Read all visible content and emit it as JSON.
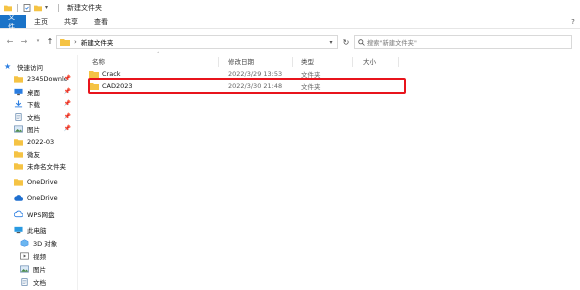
{
  "window": {
    "title": "新建文件夹"
  },
  "ribbon": {
    "tabs": [
      "文件",
      "主页",
      "共享",
      "查看"
    ],
    "help": "?"
  },
  "address": {
    "breadcrumb": "新建文件夹",
    "search_placeholder": "搜索\"新建文件夹\""
  },
  "sidebar": {
    "items": [
      {
        "label": "快速访问",
        "icon": "star-icon",
        "pinned": false
      },
      {
        "label": "2345Downlc",
        "icon": "folder-icon",
        "pinned": true
      },
      {
        "label": "桌面",
        "icon": "desktop-icon",
        "pinned": true
      },
      {
        "label": "下载",
        "icon": "download-icon",
        "pinned": true
      },
      {
        "label": "文档",
        "icon": "document-icon",
        "pinned": true
      },
      {
        "label": "图片",
        "icon": "picture-icon",
        "pinned": true
      },
      {
        "label": "2022-03",
        "icon": "folder-icon",
        "pinned": false
      },
      {
        "label": "微友",
        "icon": "folder-icon",
        "pinned": false
      },
      {
        "label": "未命名文件夹",
        "icon": "folder-icon",
        "pinned": false
      },
      {
        "label": "OneDrive",
        "icon": "folder-icon",
        "pinned": false
      },
      {
        "label": "OneDrive",
        "icon": "cloud-icon",
        "pinned": false
      },
      {
        "label": "WPS网盘",
        "icon": "cloud-drive-icon",
        "pinned": false
      },
      {
        "label": "此电脑",
        "icon": "computer-icon",
        "pinned": false
      },
      {
        "label": "3D 对象",
        "icon": "cube-icon",
        "pinned": false
      },
      {
        "label": "视频",
        "icon": "video-icon",
        "pinned": false
      },
      {
        "label": "图片",
        "icon": "picture-icon",
        "pinned": false
      },
      {
        "label": "文档",
        "icon": "document-icon",
        "pinned": false
      }
    ]
  },
  "columns": {
    "name": "名称",
    "date": "修改日期",
    "type": "类型",
    "size": "大小"
  },
  "files": [
    {
      "name": "Crack",
      "date": "2022/3/29 13:53",
      "type": "文件夹"
    },
    {
      "name": "CAD2023",
      "date": "2022/3/30 21:48",
      "type": "文件夹"
    }
  ],
  "colors": {
    "accent": "#1a73c8",
    "folder": "#f5c344",
    "highlight": "#e8141c"
  }
}
